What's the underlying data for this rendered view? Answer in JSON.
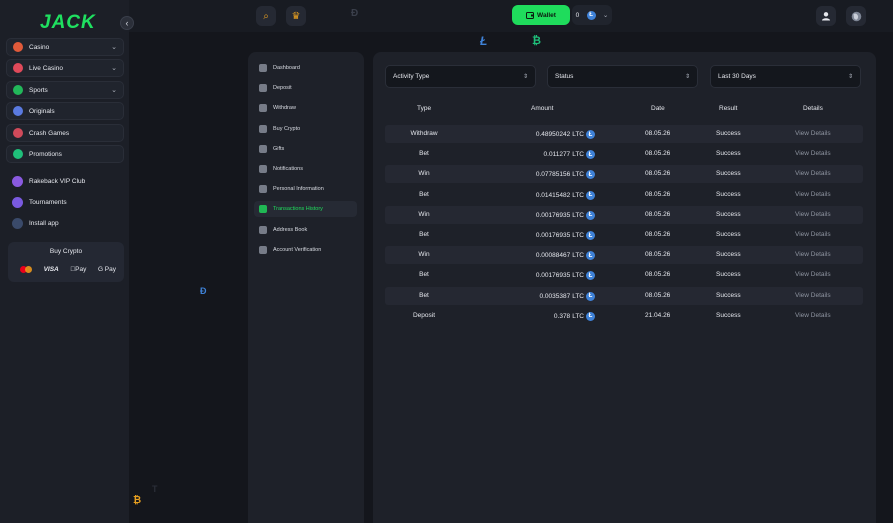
{
  "sidebar": {
    "logo": "JACK",
    "collapse_icon": "‹",
    "items": [
      {
        "label": "Casino",
        "color": "#e05a3a",
        "chevron": "⌄"
      },
      {
        "label": "Live Casino",
        "color": "#e04a5a",
        "chevron": "⌄"
      },
      {
        "label": "Sports",
        "color": "#22b85a",
        "chevron": "⌄"
      },
      {
        "label": "Originals",
        "color": "#5a7ae0"
      },
      {
        "label": "Crash Games",
        "color": "#d04a5a"
      },
      {
        "label": "Promotions",
        "color": "#1fbf7a"
      }
    ],
    "plain_items": [
      {
        "label": "Rakeback VIP Club",
        "color": "#8a5ae0"
      },
      {
        "label": "Tournaments",
        "color": "#7a5ae0"
      },
      {
        "label": "Install app",
        "color": "#3a4a6a"
      }
    ],
    "buy_crypto": {
      "title": "Buy Crypto",
      "methods": [
        "VISA",
        "Pay",
        "G Pay"
      ]
    }
  },
  "topbar": {
    "search_icon": "⌕",
    "crown_icon": "♛",
    "wallet_label": "Wallet",
    "balance": "0",
    "currency_icon": "Ł",
    "dropdown_icon": "⌄"
  },
  "settings_menu": {
    "items": [
      "Dashboard",
      "Deposit",
      "Withdraw",
      "Buy Crypto",
      "Gifts",
      "Notifications",
      "Personal Information",
      "Transactions History",
      "Address Book",
      "Account Verification"
    ],
    "active": "Transactions History"
  },
  "filters": {
    "activity_type": "Activity Type",
    "status": "Status",
    "period": "Last 30 Days",
    "arrow_icon": "⇕"
  },
  "table": {
    "headers": [
      "Type",
      "Amount",
      "Date",
      "Result",
      "Details"
    ],
    "currency": "LTC",
    "rows": [
      {
        "type": "Withdraw",
        "amount": "0.48950242",
        "date": "08.05.26",
        "result": "Success",
        "details": "View Details"
      },
      {
        "type": "Bet",
        "amount": "0.011277",
        "date": "08.05.26",
        "result": "Success",
        "details": "View Details"
      },
      {
        "type": "Win",
        "amount": "0.07785156",
        "date": "08.05.26",
        "result": "Success",
        "details": "View Details"
      },
      {
        "type": "Bet",
        "amount": "0.01415482",
        "date": "08.05.26",
        "result": "Success",
        "details": "View Details"
      },
      {
        "type": "Win",
        "amount": "0.00176935",
        "date": "08.05.26",
        "result": "Success",
        "details": "View Details"
      },
      {
        "type": "Bet",
        "amount": "0.00176935",
        "date": "08.05.26",
        "result": "Success",
        "details": "View Details"
      },
      {
        "type": "Win",
        "amount": "0.00088467",
        "date": "08.05.26",
        "result": "Success",
        "details": "View Details"
      },
      {
        "type": "Bet",
        "amount": "0.00176935",
        "date": "08.05.26",
        "result": "Success",
        "details": "View Details"
      },
      {
        "type": "Bet",
        "amount": "0.0035387",
        "date": "08.05.26",
        "result": "Success",
        "details": "View Details"
      },
      {
        "type": "Deposit",
        "amount": "0.378",
        "date": "21.04.26",
        "result": "Success",
        "details": "View Details"
      }
    ]
  }
}
